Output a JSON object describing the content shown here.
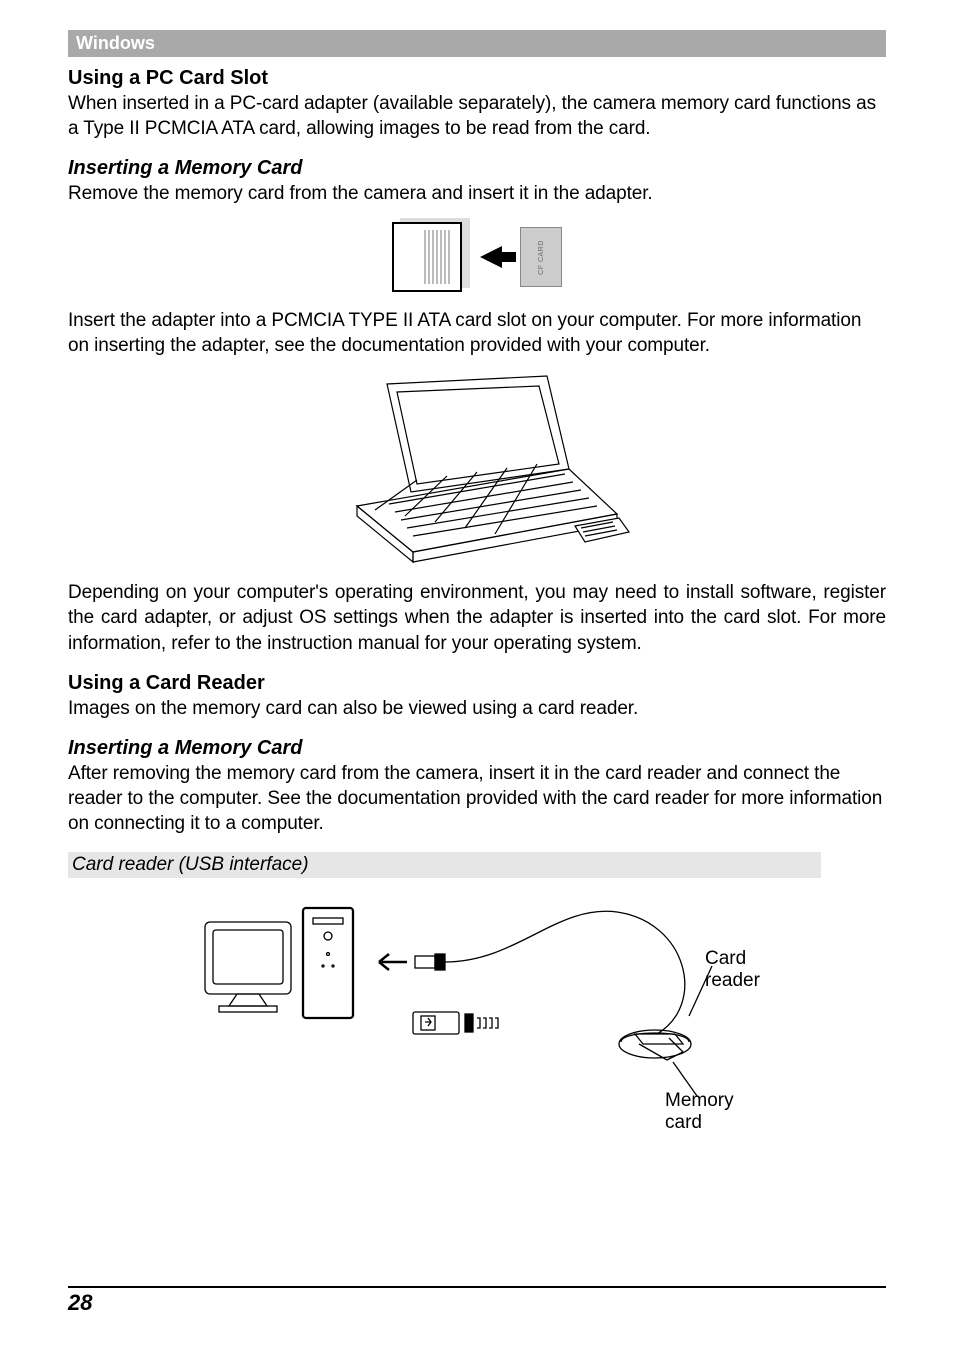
{
  "section_bar": "Windows",
  "pc_card": {
    "heading": "Using a PC Card Slot",
    "p1": "When inserted in a PC-card adapter (available separately), the camera memory card functions as a Type II PCMCIA ATA card, allowing images to be read from the card.",
    "sub1": "Inserting a Memory Card",
    "p2": "Remove the memory card from the camera and insert it in the adapter.",
    "p3": "Insert the adapter into a PCMCIA TYPE II ATA card slot on your computer. For more information on inserting the adapter, see the documentation provided with your computer.",
    "p4": "Depending on your computer's operating environment, you may need to install software, register the card adapter, or adjust OS settings when the adapter is inserted into the card slot. For more information, refer to the instruction manual for your operating system.",
    "cf_label": "CF CARD"
  },
  "card_reader": {
    "heading": "Using a Card Reader",
    "p1": "Images on the memory card can also be viewed using a card reader.",
    "sub1": "Inserting a Memory Card",
    "p2": "After removing the memory card from the camera, insert it in the card reader and connect the reader to the computer. See the documentation provided with the card reader for more information on connecting it to a computer.",
    "caption": "Card reader (USB interface)",
    "label_reader": "Card reader",
    "label_memcard": "Memory card"
  },
  "page_number": "28"
}
